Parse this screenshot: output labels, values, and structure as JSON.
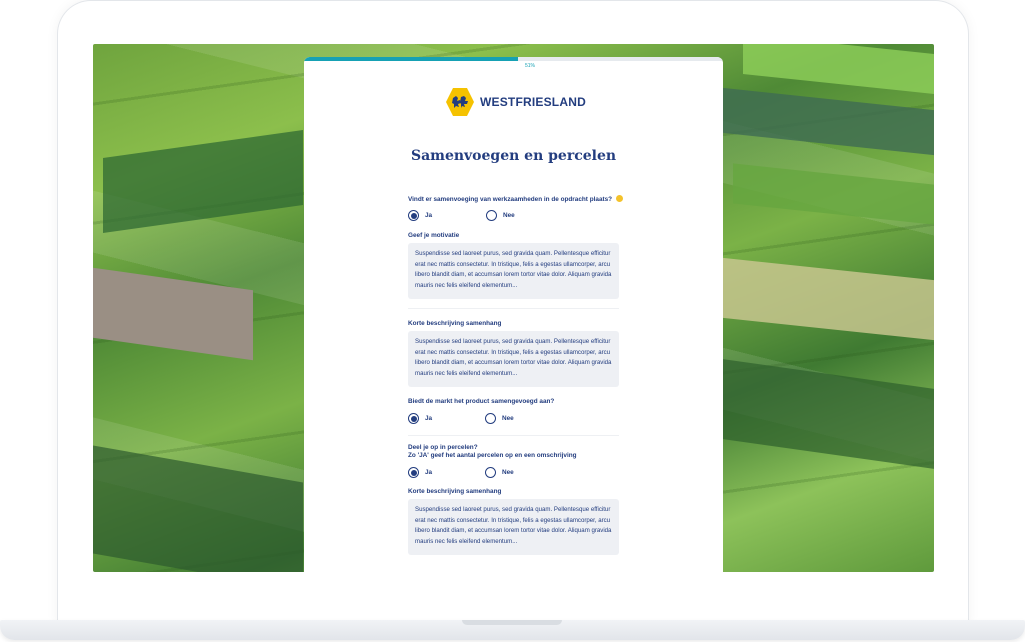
{
  "progress": {
    "label": "51%",
    "fraction": 0.51
  },
  "brand": {
    "name": "WESTFRIESLAND",
    "accent": "#f5c200",
    "primary": "#233d7f",
    "teal": "#16a1b4"
  },
  "form": {
    "title": "Samenvoegen en percelen",
    "q1": {
      "label": "Vindt er samenvoeging van werkzaamheden in de opdracht plaats?",
      "yes": "Ja",
      "no": "Nee",
      "selected": "Ja"
    },
    "motivation": {
      "label": "Geef je motivatie",
      "text": "Suspendisse sed laoreet purus, sed gravida quam. Pellentesque efficitur erat nec mattis consectetur. In tristique, felis a egestas ullamcorper, arcu libero blandit diam, et accumsan lorem tortor vitae dolor. Aliquam gravida mauris nec felis eleifend elementum..."
    },
    "description1": {
      "label": "Korte beschrijving samenhang",
      "text": "Suspendisse sed laoreet purus, sed gravida quam. Pellentesque efficitur erat nec mattis consectetur. In tristique, felis a egestas ullamcorper, arcu libero blandit diam, et accumsan lorem tortor vitae dolor. Aliquam gravida mauris nec felis eleifend elementum..."
    },
    "q2": {
      "label": "Biedt de markt het product samengevoegd aan?",
      "yes": "Ja",
      "no": "Nee",
      "selected": "Ja"
    },
    "q3": {
      "label_line1": "Deel je op in percelen?",
      "label_line2": "Zo 'JA' geef het aantal percelen op en een omschrijving",
      "yes": "Ja",
      "no": "Nee",
      "selected": "Ja"
    },
    "description2": {
      "label": "Korte beschrijving samenhang",
      "text": "Suspendisse sed laoreet purus, sed gravida quam. Pellentesque efficitur erat nec mattis consectetur. In tristique, felis a egestas ullamcorper, arcu libero blandit diam, et accumsan lorem tortor vitae dolor. Aliquam gravida mauris nec felis eleifend elementum..."
    }
  }
}
